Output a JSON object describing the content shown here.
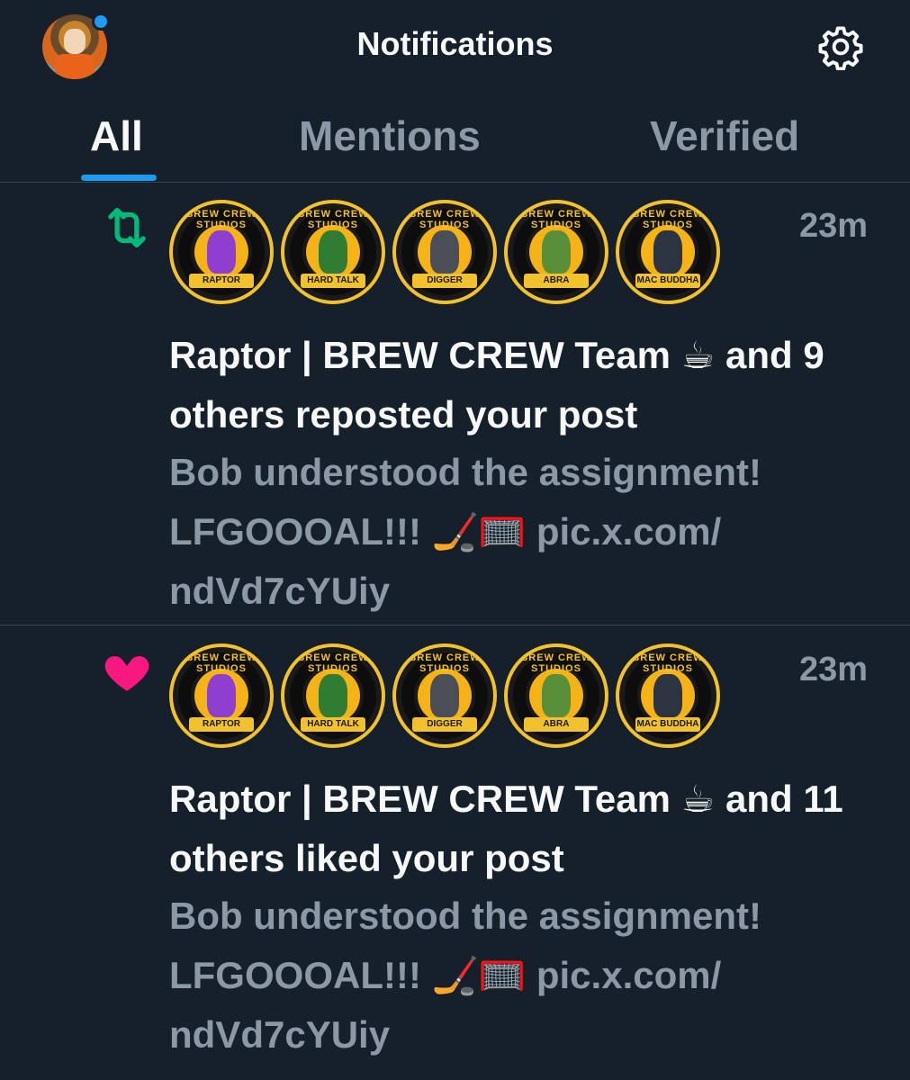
{
  "header": {
    "title": "Notifications",
    "avatar_icon": "profile-avatar",
    "settings_icon": "gear-icon",
    "accent_color": "#1d9bf0"
  },
  "tabs": [
    {
      "label": "All",
      "active": true
    },
    {
      "label": "Mentions",
      "active": false
    },
    {
      "label": "Verified",
      "active": false
    }
  ],
  "notifications": [
    {
      "type": "repost",
      "icon": "repost-icon",
      "icon_color": "#00ba7c",
      "time": "23m",
      "avatars": [
        {
          "caption": "BREW CREW STUDIOS",
          "name": "RAPTOR"
        },
        {
          "caption": "BREW CREW STUDIOS",
          "name": "HARD TALK"
        },
        {
          "caption": "BREW CREW STUDIOS",
          "name": "DIGGER"
        },
        {
          "caption": "BREW CREW STUDIOS",
          "name": "ABRA"
        },
        {
          "caption": "BREW CREW STUDIOS",
          "name": "MAC BUDDHA"
        }
      ],
      "headline": "Raptor | BREW CREW Team ☕ and 9 others reposted your post",
      "preview": "Bob understood the assignment! LFGOOOAL!!! 🏒🥅 pic.x.com/ ndVd7cYUiy"
    },
    {
      "type": "like",
      "icon": "heart-icon",
      "icon_color": "#f91880",
      "time": "23m",
      "avatars": [
        {
          "caption": "BREW CREW STUDIOS",
          "name": "RAPTOR"
        },
        {
          "caption": "BREW CREW STUDIOS",
          "name": "HARD TALK"
        },
        {
          "caption": "BREW CREW STUDIOS",
          "name": "DIGGER"
        },
        {
          "caption": "BREW CREW STUDIOS",
          "name": "ABRA"
        },
        {
          "caption": "BREW CREW STUDIOS",
          "name": "MAC BUDDHA"
        }
      ],
      "headline": "Raptor | BREW CREW Team ☕ and 11 others liked your post",
      "preview": "Bob understood the assignment! LFGOOOAL!!! 🏒🥅 pic.x.com/ ndVd7cYUiy"
    }
  ]
}
